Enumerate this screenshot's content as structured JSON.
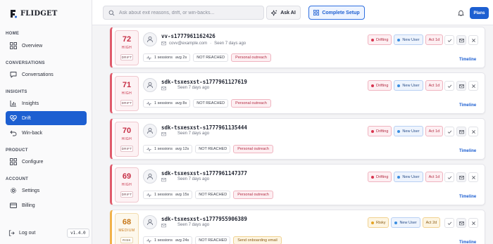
{
  "app": {
    "name": "FLIDGET"
  },
  "sidebar": {
    "sections": [
      {
        "label": "HOME"
      },
      {
        "label": "CONVERSATIONS"
      },
      {
        "label": "INSIGHTS"
      },
      {
        "label": "PRODUCT"
      },
      {
        "label": "ACCOUNT"
      }
    ],
    "items": [
      {
        "label": "Overview",
        "icon": "grid-icon"
      },
      {
        "label": "Conversations",
        "icon": "chat-icon"
      },
      {
        "label": "Insights",
        "icon": "bar-chart-icon"
      },
      {
        "label": "Drift",
        "icon": "heart-pulse-icon",
        "active": true
      },
      {
        "label": "Win-back",
        "icon": "undo-icon"
      },
      {
        "label": "Configure",
        "icon": "grid-icon"
      },
      {
        "label": "Settings",
        "icon": "gear-icon"
      },
      {
        "label": "Billing",
        "icon": "credit-card-icon"
      }
    ],
    "logout_label": "Log out",
    "version": "v1.4.0"
  },
  "topbar": {
    "search_placeholder": "Ask about exit reasons, drift, or win-backs...",
    "ask_ai_label": "Ask AI",
    "setup_label": "Complete Setup",
    "plans_label": "Plans"
  },
  "colors": {
    "accent": "#1d5fd1",
    "drift": "#d8344f",
    "risky": "#e5a323",
    "new_user": "#3a8de0"
  },
  "users": [
    {
      "score": "72",
      "level": "HIGH",
      "stage": "DRIFT",
      "user_id": "vv-s1777961162426",
      "email": "covv@example.com",
      "has_email": true,
      "seen": "Seen 7 days ago",
      "sessions": "1 sessions",
      "avg": "avg 2s",
      "reach": "NOT REACHED",
      "action": "Personal outreach",
      "status": "Drifting",
      "segment": "New User",
      "act": "Act 1d",
      "timeline": "Timeline",
      "tone": "drift"
    },
    {
      "score": "71",
      "level": "HIGH",
      "stage": "DRIFT",
      "user_id": "sdk-tsxesxst-s1777961127619",
      "email": "",
      "has_email": false,
      "seen": "Seen 7 days ago",
      "sessions": "1 sessions",
      "avg": "avg 8s",
      "reach": "NOT REACHED",
      "action": "Personal outreach",
      "status": "Drifting",
      "segment": "New User",
      "act": "Act 1d",
      "timeline": "Timeline",
      "tone": "drift"
    },
    {
      "score": "70",
      "level": "HIGH",
      "stage": "DRIFT",
      "user_id": "sdk-tsxesxst-s1777961135444",
      "email": "",
      "has_email": false,
      "seen": "Seen 7 days ago",
      "sessions": "1 sessions",
      "avg": "avg 12s",
      "reach": "NOT REACHED",
      "action": "Personal outreach",
      "status": "Drifting",
      "segment": "New User",
      "act": "Act 1d",
      "timeline": "Timeline",
      "tone": "drift"
    },
    {
      "score": "69",
      "level": "HIGH",
      "stage": "DRIFT",
      "user_id": "sdk-tsxesxst-s1777961147377",
      "email": "",
      "has_email": false,
      "seen": "Seen 7 days ago",
      "sessions": "1 sessions",
      "avg": "avg 15s",
      "reach": "NOT REACHED",
      "action": "Personal outreach",
      "status": "Drifting",
      "segment": "New User",
      "act": "Act 1d",
      "timeline": "Timeline",
      "tone": "drift"
    },
    {
      "score": "68",
      "level": "MEDIUM",
      "stage": "RISK",
      "user_id": "sdk-tsxesxst-s1777955906389",
      "email": "",
      "has_email": false,
      "seen": "Seen 7 days ago",
      "sessions": "1 sessions",
      "avg": "avg 24s",
      "reach": "NOT REACHED",
      "action": "Send onboarding email",
      "status": "Risky",
      "segment": "New User",
      "act": "Act 2d",
      "timeline": "Timeline",
      "tone": "risky"
    }
  ]
}
